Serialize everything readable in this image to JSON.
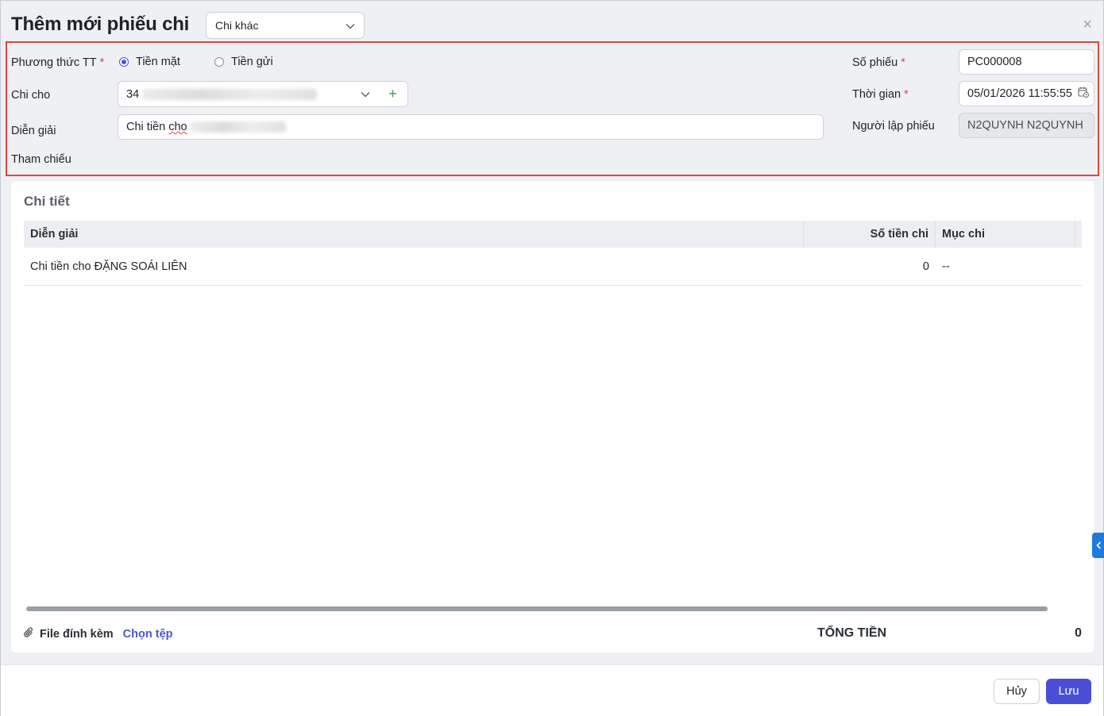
{
  "header": {
    "title": "Thêm mới phiếu chi",
    "type_select": "Chi khác",
    "close_icon": "close-icon"
  },
  "form": {
    "payment_method_label": "Phương thức TT",
    "payment_options": [
      {
        "label": "Tiền mặt",
        "selected": true
      },
      {
        "label": "Tiền gửi",
        "selected": false
      }
    ],
    "pay_to_label": "Chi cho",
    "pay_to_value": "34",
    "add_button": "+",
    "description_label": "Diễn giải",
    "description_value_prefix": "Chi tiền",
    "description_value_word": "cho",
    "reference_label": "Tham chiếu",
    "voucher_no_label": "Số phiếu",
    "voucher_no_value": "PC000008",
    "time_label": "Thời gian",
    "time_value": "05/01/2026 11:55:55",
    "creator_label": "Người lập phiếu",
    "creator_value": "N2QUYNH N2QUYNH",
    "required_mark": "*"
  },
  "details": {
    "title": "Chi tiết",
    "columns": [
      "Diễn giải",
      "Số tiền chi",
      "Mục chi"
    ],
    "rows": [
      {
        "description": "Chi tiền cho ĐẶNG SOÁI LIÊN",
        "amount": "0",
        "category": "--"
      }
    ],
    "attach_label": "File đính kèm",
    "choose_file": "Chọn tệp",
    "total_label": "TỔNG TIỀN",
    "total_value": "0"
  },
  "footer": {
    "cancel": "Hủy",
    "save": "Lưu"
  },
  "colors": {
    "accent": "#4a4fd6",
    "required": "#e0463f",
    "highlight_border": "#e0463f"
  }
}
